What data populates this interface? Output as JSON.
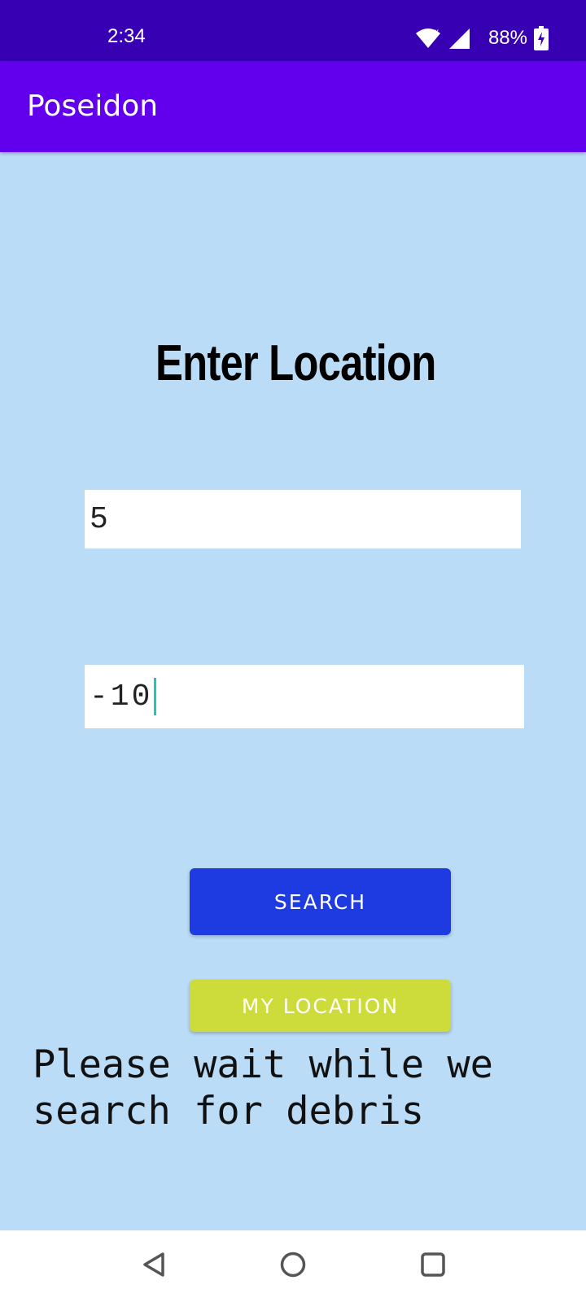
{
  "status_bar": {
    "time": "2:34",
    "battery_percent": "88%",
    "icons": [
      "wifi-icon",
      "signal-icon",
      "battery-charging-icon"
    ]
  },
  "app_bar": {
    "title": "Poseidon"
  },
  "main": {
    "heading": "Enter Location",
    "latitude_value": "5",
    "longitude_value": "-10",
    "search_label": "SEARCH",
    "my_location_label": "MY LOCATION",
    "status_message": "Please wait while we search for debris"
  },
  "nav_bar": {
    "icons": [
      "back-icon",
      "home-icon",
      "recents-icon"
    ]
  },
  "colors": {
    "status_bar": "#3700b3",
    "app_bar": "#6200ee",
    "background": "#bbdcf6",
    "search_button": "#1d3be1",
    "my_location_button": "#cddc3a",
    "caret": "#1ec9b0"
  }
}
